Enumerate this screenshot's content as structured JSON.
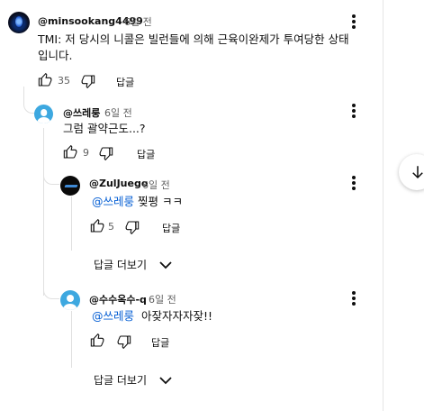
{
  "comments": {
    "top": {
      "author": "@minsookang4499",
      "time": "6일 전",
      "text_line1": "TMI: 저 당시의 니콜은 빌런들에 의해 근육이완제가 투여당한 상태",
      "text_line2": "입니다.",
      "likes": "35",
      "reply_label": "답글"
    },
    "reply1": {
      "author": "@쓰레룽",
      "time": "6일 전",
      "text": "그럼 괄약근도...?",
      "likes": "9",
      "reply_label": "답글"
    },
    "reply2": {
      "author": "@ZulJuego",
      "time": "6일 전",
      "mention": "@쓰레룽",
      "text": " 찢평 ㅋㅋ",
      "likes": "5",
      "reply_label": "답글",
      "more_replies_label": "답글 더보기"
    },
    "reply3": {
      "author": "@수수옥수-q",
      "time": "6일 전",
      "mention": "@쓰레룽",
      "text": "  아잦자자자잦!!",
      "reply_label": "답글",
      "more_replies_label": "답글 더보기"
    }
  },
  "icons": {
    "like": "thumbs-up-icon",
    "dislike": "thumbs-down-icon",
    "menu": "more-vert-icon",
    "chevron": "chevron-down-icon",
    "scroll": "arrow-down-icon"
  }
}
